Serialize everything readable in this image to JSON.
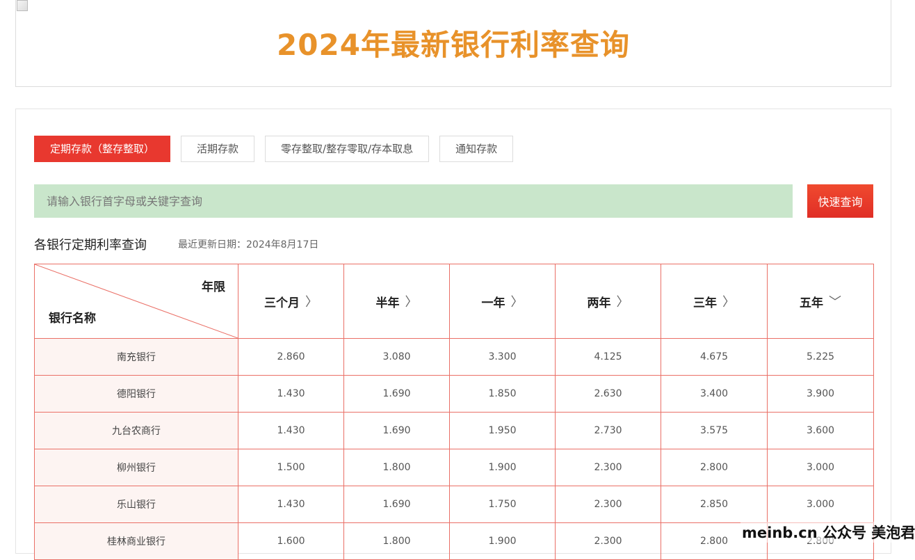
{
  "header": {
    "title": "2024年最新银行利率查询"
  },
  "tabs": [
    {
      "label": "定期存款（整存整取）",
      "active": true
    },
    {
      "label": "活期存款",
      "active": false
    },
    {
      "label": "零存整取/整存零取/存本取息",
      "active": false
    },
    {
      "label": "通知存款",
      "active": false
    }
  ],
  "search": {
    "placeholder": "请输入银行首字母或关键字查询",
    "button_label": "快速查询"
  },
  "section": {
    "title": "各银行定期利率查询",
    "update_label": "最近更新日期：2024年8月17日"
  },
  "table": {
    "corner_top": "年限",
    "corner_bottom": "银行名称",
    "columns": [
      {
        "label": "三个月",
        "sort_icon": "chevron-right-icon",
        "chevron": "〉"
      },
      {
        "label": "半年",
        "sort_icon": "chevron-right-icon",
        "chevron": "〉"
      },
      {
        "label": "一年",
        "sort_icon": "chevron-right-icon",
        "chevron": "〉"
      },
      {
        "label": "两年",
        "sort_icon": "chevron-right-icon",
        "chevron": "〉"
      },
      {
        "label": "三年",
        "sort_icon": "chevron-right-icon",
        "chevron": "〉"
      },
      {
        "label": "五年",
        "sort_icon": "chevron-down-icon",
        "chevron": "﹀"
      }
    ],
    "rows": [
      {
        "bank": "南充银行",
        "values": [
          "2.860",
          "3.080",
          "3.300",
          "4.125",
          "4.675",
          "5.225"
        ]
      },
      {
        "bank": "德阳银行",
        "values": [
          "1.430",
          "1.690",
          "1.850",
          "2.630",
          "3.400",
          "3.900"
        ]
      },
      {
        "bank": "九台农商行",
        "values": [
          "1.430",
          "1.690",
          "1.950",
          "2.730",
          "3.575",
          "3.600"
        ]
      },
      {
        "bank": "柳州银行",
        "values": [
          "1.500",
          "1.800",
          "1.900",
          "2.300",
          "2.800",
          "3.000"
        ]
      },
      {
        "bank": "乐山银行",
        "values": [
          "1.430",
          "1.690",
          "1.750",
          "2.300",
          "2.850",
          "3.000"
        ]
      },
      {
        "bank": "桂林商业银行",
        "values": [
          "1.600",
          "1.800",
          "1.900",
          "2.300",
          "2.800",
          "2.800"
        ]
      }
    ]
  },
  "watermark": {
    "text": "meinb.cn 公众号 美泡君"
  },
  "colors": {
    "accent": "#e8382f",
    "title": "#e8922a",
    "search_bg": "#c9e6cb",
    "border": "#ea6f66"
  }
}
